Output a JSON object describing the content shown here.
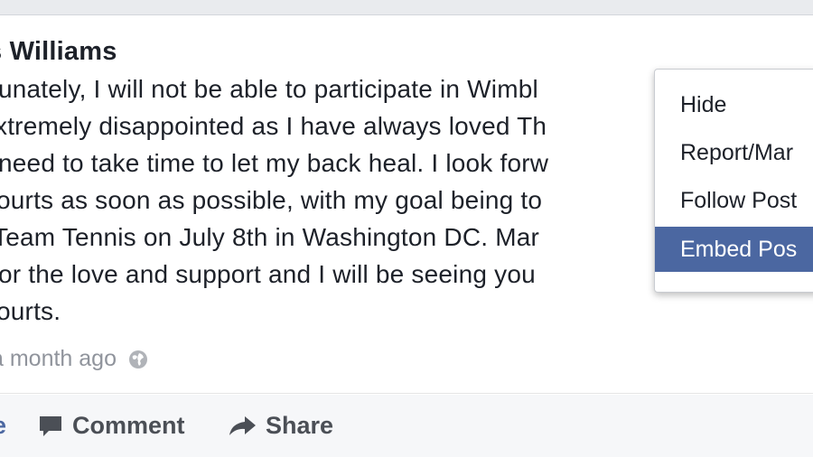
{
  "post": {
    "author": "s Williams",
    "body_lines": [
      "tunately, I will not be able to participate in Wimbl",
      "xtremely disappointed as I have always loved Th",
      "need to take time to let my back heal. I look forw",
      "ourts as soon as possible, with my goal being to",
      " Team Tennis on July 8th in Washington DC. Mar",
      "or the love and support and I will be seeing you",
      "ourts."
    ],
    "timestamp": "a month ago",
    "privacy_icon": "globe-icon"
  },
  "actions": {
    "like_fragment": "e",
    "comment_label": "Comment",
    "share_label": "Share"
  },
  "menu": {
    "items": [
      {
        "label": "Hide",
        "highlighted": false
      },
      {
        "label": "Report/Mar",
        "highlighted": false
      },
      {
        "label": "Follow Post",
        "highlighted": false
      },
      {
        "label": "Embed Pos",
        "highlighted": true
      }
    ]
  },
  "colors": {
    "facebook_blue": "#4b67a1",
    "text": "#1d2129",
    "muted": "#90949c"
  }
}
